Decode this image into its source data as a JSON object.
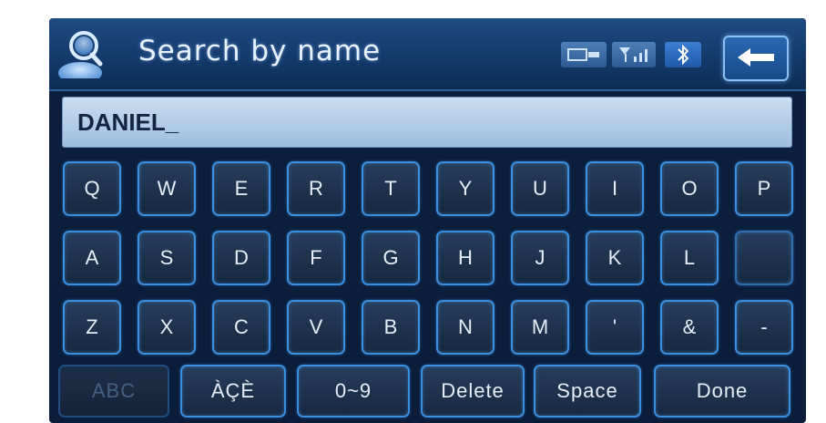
{
  "header": {
    "title": "Search by name",
    "icon": "person-search-icon",
    "status_icons": [
      "media-icon",
      "signal-icon",
      "bluetooth-icon"
    ],
    "back_icon": "back-arrow-icon"
  },
  "input": {
    "value": "DANIEL_"
  },
  "keyboard": {
    "row1": [
      "Q",
      "W",
      "E",
      "R",
      "T",
      "Y",
      "U",
      "I",
      "O",
      "P"
    ],
    "row2": [
      "A",
      "S",
      "D",
      "F",
      "G",
      "H",
      "J",
      "K",
      "L",
      ""
    ],
    "row3": [
      "Z",
      "X",
      "C",
      "V",
      "B",
      "N",
      "M",
      "'",
      "&",
      "-"
    ],
    "actions": [
      "ABC",
      "ÀÇÈ",
      "0~9",
      "Delete",
      "Space",
      "Done"
    ]
  },
  "colors": {
    "accent": "#3b8fde",
    "background": "#0c1f3c",
    "input_bg": "#b4cfe8"
  }
}
